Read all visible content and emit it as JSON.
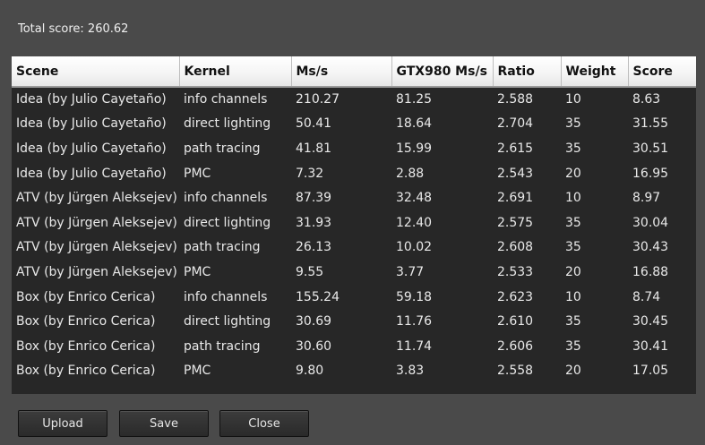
{
  "total_score": "Total score: 260.62",
  "table": {
    "headers": [
      "Scene",
      "Kernel",
      "Ms/s",
      "GTX980 Ms/s",
      "Ratio",
      "Weight",
      "Score"
    ],
    "rows": [
      [
        "Idea (by Julio Cayetaño)",
        "info channels",
        "210.27",
        "81.25",
        "2.588",
        "10",
        "8.63"
      ],
      [
        "Idea (by Julio Cayetaño)",
        "direct lighting",
        "50.41",
        "18.64",
        "2.704",
        "35",
        "31.55"
      ],
      [
        "Idea (by Julio Cayetaño)",
        "path tracing",
        "41.81",
        "15.99",
        "2.615",
        "35",
        "30.51"
      ],
      [
        "Idea (by Julio Cayetaño)",
        "PMC",
        "7.32",
        "2.88",
        "2.543",
        "20",
        "16.95"
      ],
      [
        "ATV (by Jürgen Aleksejev)",
        "info channels",
        "87.39",
        "32.48",
        "2.691",
        "10",
        "8.97"
      ],
      [
        "ATV (by Jürgen Aleksejev)",
        "direct lighting",
        "31.93",
        "12.40",
        "2.575",
        "35",
        "30.04"
      ],
      [
        "ATV (by Jürgen Aleksejev)",
        "path tracing",
        "26.13",
        "10.02",
        "2.608",
        "35",
        "30.43"
      ],
      [
        "ATV (by Jürgen Aleksejev)",
        "PMC",
        "9.55",
        "3.77",
        "2.533",
        "20",
        "16.88"
      ],
      [
        "Box (by Enrico Cerica)",
        "info channels",
        "155.24",
        "59.18",
        "2.623",
        "10",
        "8.74"
      ],
      [
        "Box (by Enrico Cerica)",
        "direct lighting",
        "30.69",
        "11.76",
        "2.610",
        "35",
        "30.45"
      ],
      [
        "Box (by Enrico Cerica)",
        "path tracing",
        "30.60",
        "11.74",
        "2.606",
        "35",
        "30.41"
      ],
      [
        "Box (by Enrico Cerica)",
        "PMC",
        "9.80",
        "3.83",
        "2.558",
        "20",
        "17.05"
      ]
    ]
  },
  "buttons": {
    "upload": "Upload",
    "save": "Save",
    "close": "Close"
  }
}
